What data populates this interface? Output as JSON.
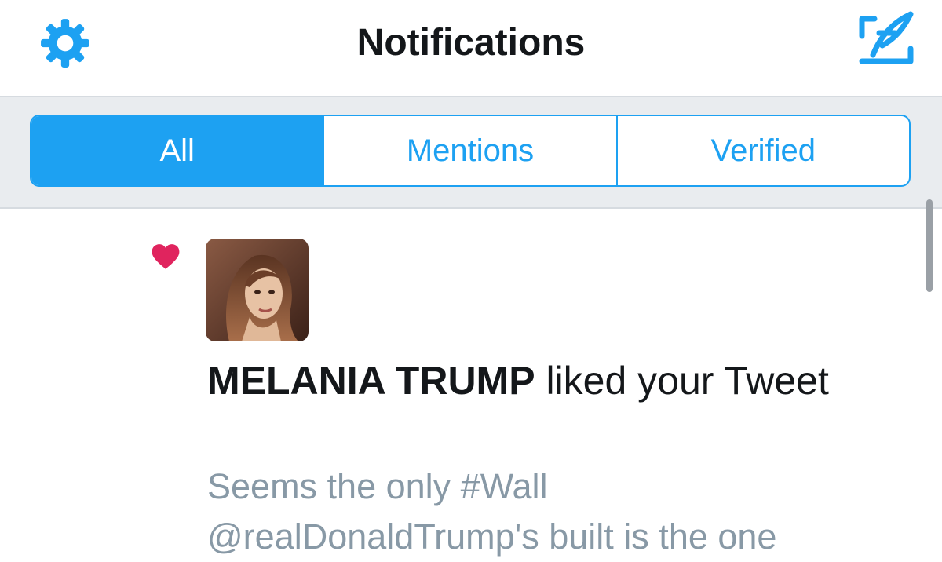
{
  "header": {
    "title": "Notifications",
    "settings_icon": "gear-icon",
    "compose_icon": "compose-tweet-icon"
  },
  "tabs": [
    {
      "label": "All",
      "active": true
    },
    {
      "label": "Mentions",
      "active": false
    },
    {
      "label": "Verified",
      "active": false
    }
  ],
  "notification": {
    "icon": "heart-icon",
    "user_name": "MELANIA TRUMP",
    "action": " liked your Tweet",
    "tweet_line_1": "Seems the only #Wall",
    "tweet_line_2": "@realDonaldTrump's built is the one"
  },
  "colors": {
    "accent": "#1da1f2",
    "like": "#e0245e",
    "secondary_text": "#8899a6",
    "segment_background": "#e9ecef"
  }
}
